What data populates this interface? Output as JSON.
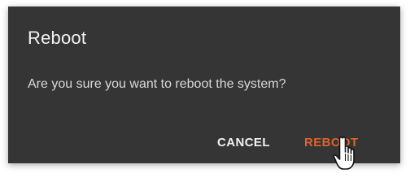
{
  "dialog": {
    "title": "Reboot",
    "message": "Are you sure you want to reboot the system?",
    "cancel_label": "CANCEL",
    "confirm_label": "REBOOT"
  },
  "colors": {
    "dialog_background": "#353535",
    "text_primary": "#f2f2f2",
    "confirm_accent": "#e0642c"
  },
  "icons": {
    "cursor": "hand-pointer-icon"
  }
}
